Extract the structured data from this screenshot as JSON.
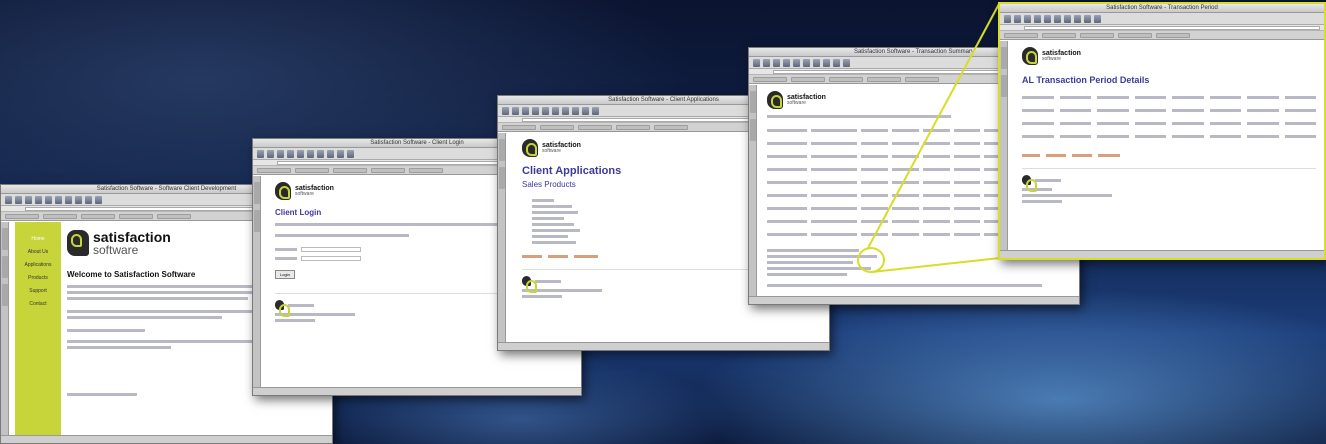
{
  "window1": {
    "title": "Satisfaction Software - Software Client Development",
    "nav_items": [
      "Home",
      "About Us",
      "Applications",
      "Products",
      "Support",
      "Contact"
    ],
    "logo_name": "satisfaction",
    "logo_sub": "software",
    "heading": "Welcome to Satisfaction Software"
  },
  "window2": {
    "title": "Satisfaction Software - Client Login",
    "logo_name": "satisfaction",
    "logo_sub": "software",
    "heading": "Client Login",
    "button_label": "Login"
  },
  "window3": {
    "title": "Satisfaction Software - Client Applications",
    "logo_name": "satisfaction",
    "logo_sub": "software",
    "heading": "Client Applications",
    "subheading": "Sales Products"
  },
  "window4": {
    "title": "Satisfaction Software - Transaction Summary",
    "logo_name": "satisfaction",
    "logo_sub": "software"
  },
  "window5": {
    "title": "Satisfaction Software - Transaction Period",
    "logo_name": "satisfaction",
    "logo_sub": "software",
    "heading": "AL Transaction Period Details"
  },
  "colors": {
    "accent_green": "#c7d43a",
    "heading_purple": "#3d3a9a",
    "callout_yellow": "#d8dd27"
  }
}
